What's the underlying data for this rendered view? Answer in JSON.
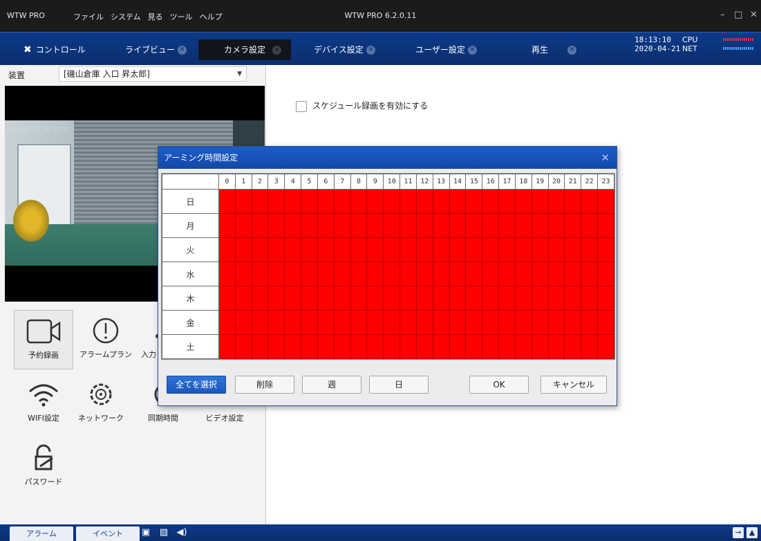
{
  "titlebar": {
    "app": "WTW PRO",
    "menu": [
      "ファイル",
      "システム",
      "見る",
      "ツール",
      "ヘルプ"
    ],
    "center": "WTW PRO 6.2.0.11",
    "minimize": "–",
    "maximize": "□",
    "close": "✕"
  },
  "tabs": [
    {
      "label": "コントロール",
      "active": false,
      "closable": false
    },
    {
      "label": "ライブビュー",
      "active": false,
      "closable": true
    },
    {
      "label": "カメラ設定",
      "active": true,
      "closable": true
    },
    {
      "label": "デバイス設定",
      "active": false,
      "closable": true
    },
    {
      "label": "ユーザー設定",
      "active": false,
      "closable": true
    },
    {
      "label": "再生",
      "active": false,
      "closable": true
    }
  ],
  "clock": {
    "time": "18:13:10",
    "date": "2020-04-21"
  },
  "meters": {
    "cpu": "CPU",
    "net": "NET"
  },
  "device": {
    "label": "装置",
    "value": "[磯山倉庫 入口 昇太郎]"
  },
  "video": {
    "timestamp": "2020-04-21 18:13:12"
  },
  "icons": [
    {
      "label": "予約録画",
      "icon": "video-camera-icon",
      "selected": true
    },
    {
      "label": "アラームプラン",
      "icon": "alert-circle-icon",
      "selected": false
    },
    {
      "label": "入力",
      "icon": "input-icon",
      "selected": false
    },
    {
      "label": "WIFI設定",
      "icon": "wifi-icon",
      "selected": false
    },
    {
      "label": "ネットワーク",
      "icon": "network-gear-icon",
      "selected": false
    },
    {
      "label": "同期時間",
      "icon": "sync-time-icon",
      "selected": false
    },
    {
      "label": "ビデオ設定",
      "icon": "video-settings-icon",
      "selected": false
    },
    {
      "label": "パスワード",
      "icon": "lock-icon",
      "selected": false
    }
  ],
  "schedule_checkbox": {
    "label": "スケジュール録画を有効にする",
    "checked": false
  },
  "dialog": {
    "title": "アーミング時間設定",
    "close": "✕",
    "hours": [
      "0",
      "1",
      "2",
      "3",
      "4",
      "5",
      "6",
      "7",
      "8",
      "9",
      "10",
      "11",
      "12",
      "13",
      "14",
      "15",
      "16",
      "17",
      "18",
      "19",
      "20",
      "21",
      "22",
      "23"
    ],
    "days": [
      "日",
      "月",
      "火",
      "水",
      "木",
      "金",
      "土"
    ],
    "all_selected": true,
    "cell_color": "#ff0000",
    "buttons": {
      "select_all": "全てを選択",
      "delete": "削除",
      "week": "週",
      "day": "日",
      "ok": "OK",
      "cancel": "キャンセル"
    }
  },
  "statusbar": {
    "alarm": "アラーム",
    "event": "イベント"
  }
}
